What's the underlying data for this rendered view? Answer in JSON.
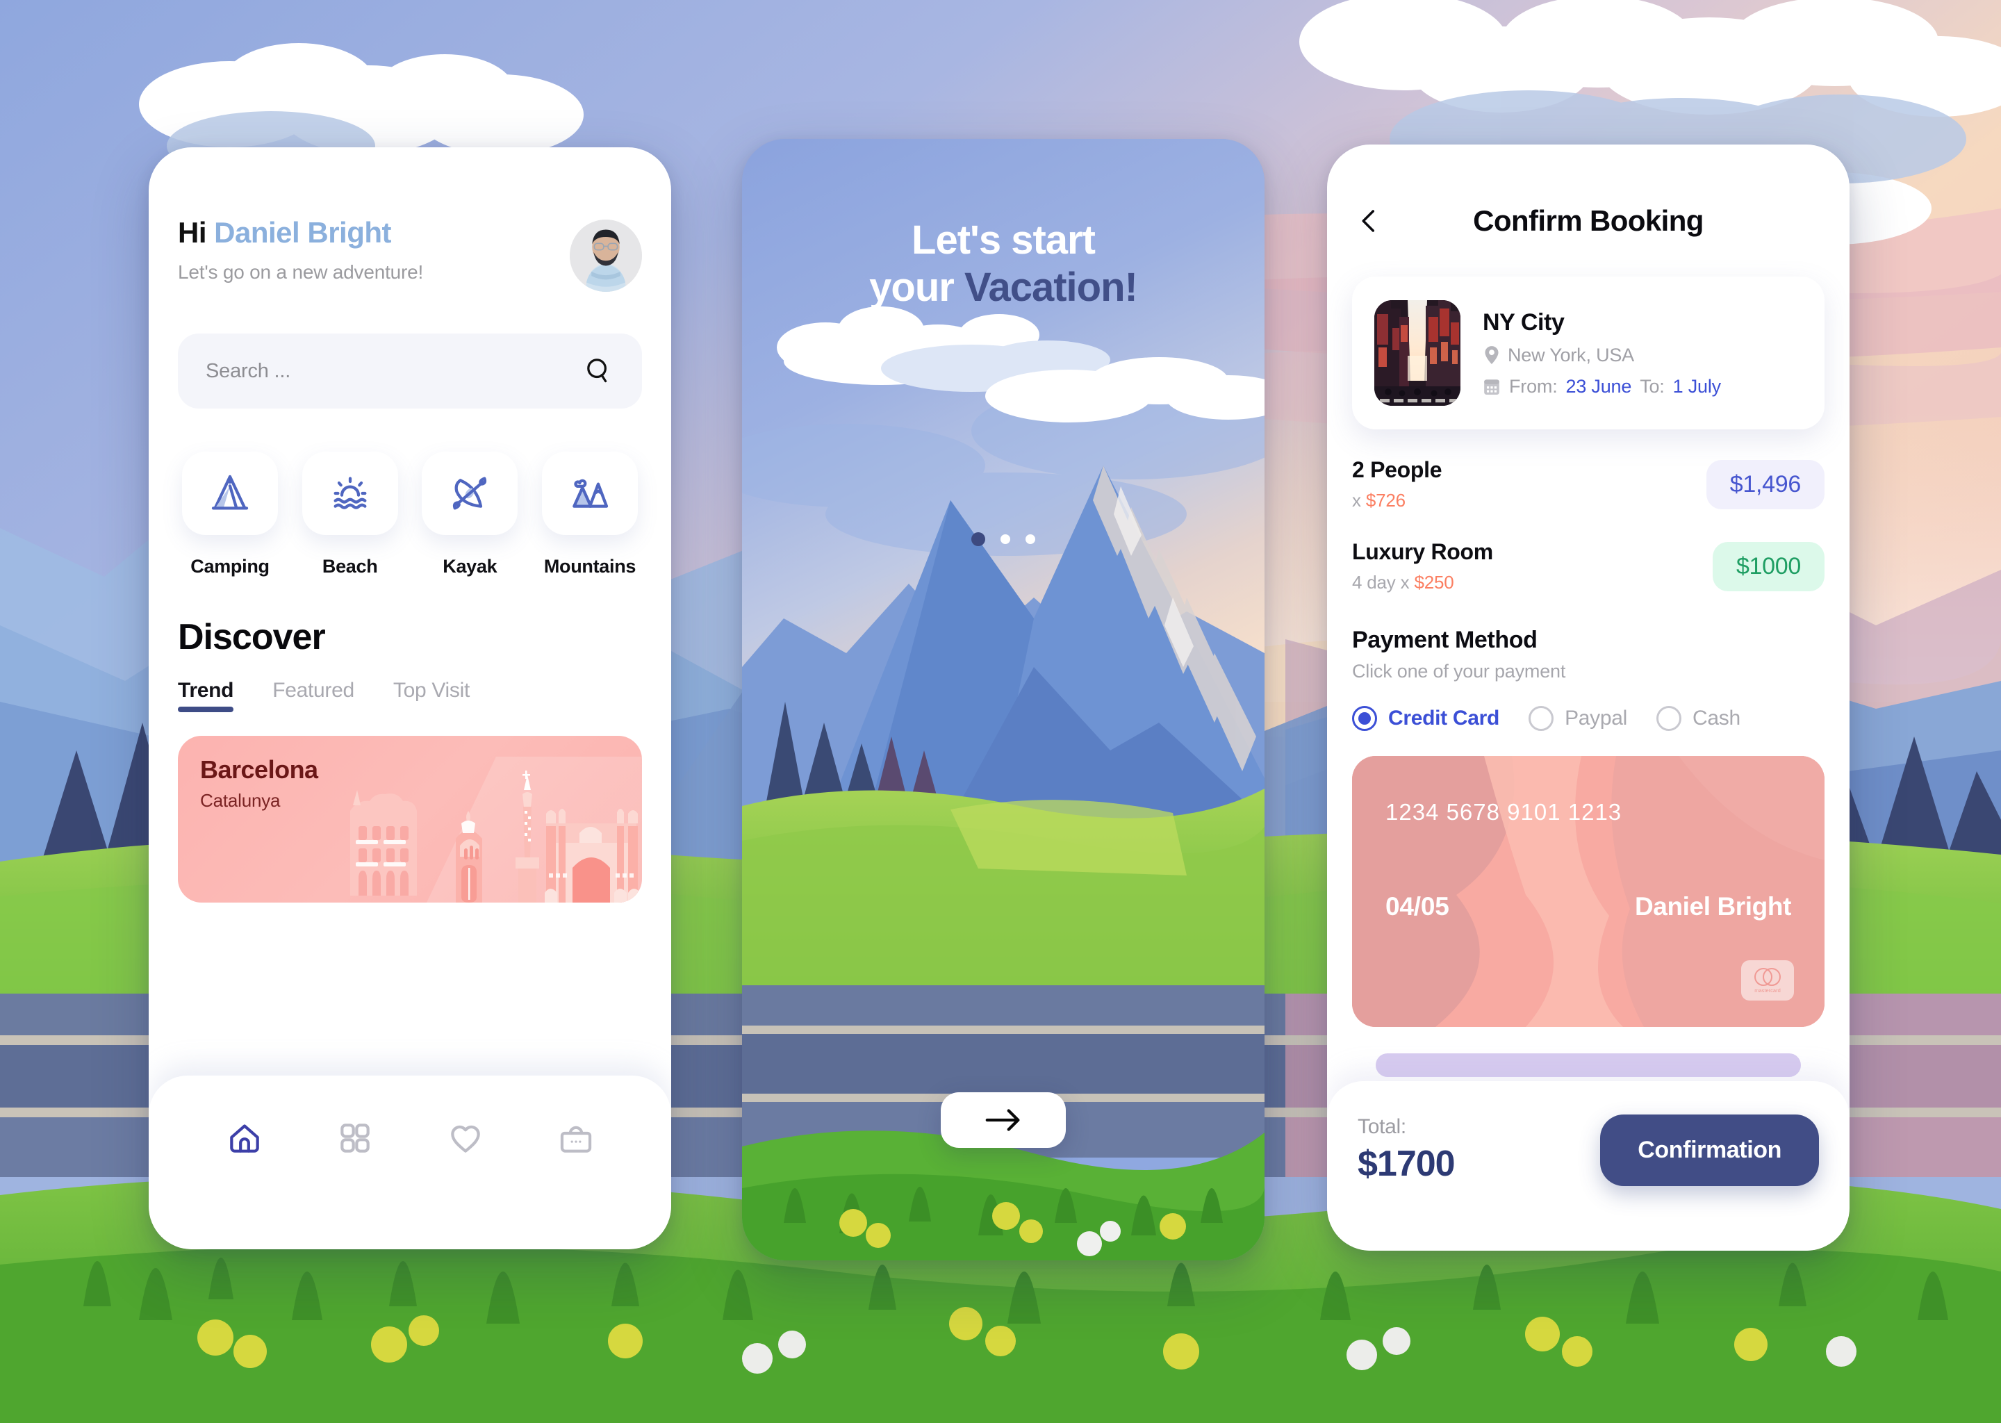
{
  "background": {
    "scene": "mountain-landscape-illustration"
  },
  "phone_home": {
    "greeting_prefix": "Hi",
    "user_name": "Daniel Bright",
    "subtitle": "Let's go on a new adventure!",
    "avatar_alt": "user-avatar",
    "search": {
      "placeholder": "Search ...",
      "value": "",
      "icon": "search-icon"
    },
    "categories": [
      {
        "label": "Camping",
        "icon": "tent-icon"
      },
      {
        "label": "Beach",
        "icon": "sun-waves-icon"
      },
      {
        "label": "Kayak",
        "icon": "kayak-icon"
      },
      {
        "label": "Mountains",
        "icon": "mountains-icon"
      }
    ],
    "discover_title": "Discover",
    "tabs": [
      {
        "label": "Trend",
        "active": true
      },
      {
        "label": "Featured",
        "active": false
      },
      {
        "label": "Top Visit",
        "active": false
      }
    ],
    "destination": {
      "name": "Barcelona",
      "region": "Catalunya",
      "card_color": "#fcb3b0"
    },
    "bottom_nav": [
      {
        "icon": "home-icon",
        "active": true
      },
      {
        "icon": "grid-icon",
        "active": false
      },
      {
        "icon": "heart-icon",
        "active": false
      },
      {
        "icon": "bag-icon",
        "active": false
      }
    ]
  },
  "phone_onboarding": {
    "headline_line1": "Let's start",
    "headline_line2_plain": "your ",
    "headline_line2_accent": "Vacation!",
    "accent_color": "#414f88",
    "dots": {
      "total": 3,
      "active_index": 0
    },
    "next_button_icon": "arrow-right-icon"
  },
  "phone_booking": {
    "back_icon": "chevron-left-icon",
    "title": "Confirm Booking",
    "trip": {
      "thumb_alt": "ny-city-photo",
      "name": "NY City",
      "location": "New York, USA",
      "location_icon": "map-pin-icon",
      "date_icon": "calendar-icon",
      "from_label": "From:",
      "from_value": "23 June",
      "to_label": "To:",
      "to_value": "1 July"
    },
    "line_items": [
      {
        "label": "2 People",
        "sub_prefix": "x ",
        "sub_value": "$726",
        "amount": "$1,496",
        "badge_style": "blue"
      },
      {
        "label": "Luxury Room",
        "sub_prefix": "4 day x ",
        "sub_value": "$250",
        "amount": "$1000",
        "badge_style": "green"
      }
    ],
    "payment": {
      "heading": "Payment Method",
      "subheading": "Click one of your payment",
      "options": [
        {
          "label": "Credit Card",
          "selected": true
        },
        {
          "label": "Paypal",
          "selected": false
        },
        {
          "label": "Cash",
          "selected": false
        }
      ]
    },
    "card": {
      "number": "1234 5678 9101 1213",
      "expiry": "04/05",
      "holder": "Daniel Bright",
      "brand": "mastercard",
      "color": "#f5a9a2"
    },
    "footer": {
      "total_label": "Total:",
      "total_value": "$1700",
      "confirm_label": "Confirmation",
      "confirm_color": "#414d86"
    }
  }
}
